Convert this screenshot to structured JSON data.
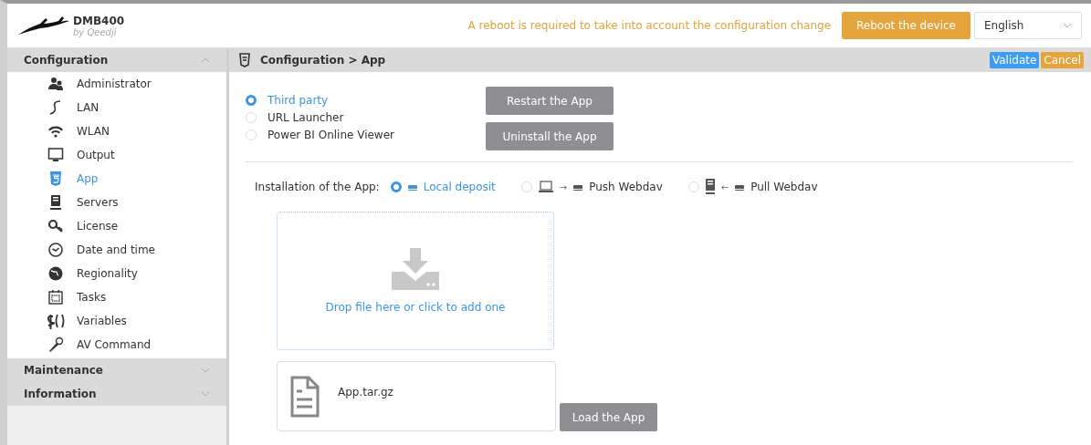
{
  "header": {
    "product": "DMB400",
    "vendor": "by Qeedji",
    "notice": "A reboot is required to take into account the configuration change",
    "reboot_button": "Reboot the device",
    "language": "English"
  },
  "sidebar": {
    "sections": [
      {
        "label": "Configuration",
        "expanded": true,
        "items": [
          {
            "label": "Administrator",
            "selected": false
          },
          {
            "label": "LAN",
            "selected": false
          },
          {
            "label": "WLAN",
            "selected": false
          },
          {
            "label": "Output",
            "selected": false
          },
          {
            "label": "App",
            "selected": true
          },
          {
            "label": "Servers",
            "selected": false
          },
          {
            "label": "License",
            "selected": false
          },
          {
            "label": "Date and time",
            "selected": false
          },
          {
            "label": "Regionality",
            "selected": false
          },
          {
            "label": "Tasks",
            "selected": false
          },
          {
            "label": "Variables",
            "selected": false
          },
          {
            "label": "AV Command",
            "selected": false
          }
        ]
      },
      {
        "label": "Maintenance",
        "expanded": false
      },
      {
        "label": "Information",
        "expanded": false
      }
    ]
  },
  "main": {
    "breadcrumb": "Configuration > App",
    "validate": "Validate",
    "cancel": "Cancel",
    "app_types": [
      {
        "label": "Third party",
        "selected": true
      },
      {
        "label": "URL Launcher",
        "selected": false
      },
      {
        "label": "Power BI Online Viewer",
        "selected": false
      }
    ],
    "app_buttons": [
      "Restart the App",
      "Uninstall the App"
    ],
    "install_label": "Installation of the App:",
    "install_options": [
      {
        "kind": "local",
        "label": "Local deposit",
        "selected": true
      },
      {
        "kind": "push",
        "arrow": "→",
        "label": "Push Webdav",
        "selected": false
      },
      {
        "kind": "pull",
        "arrow": "←",
        "label": "Pull Webdav",
        "selected": false
      }
    ],
    "dropzone": "Drop file here or click to add one",
    "file": "App.tar.gz",
    "load_button": "Load the App"
  }
}
